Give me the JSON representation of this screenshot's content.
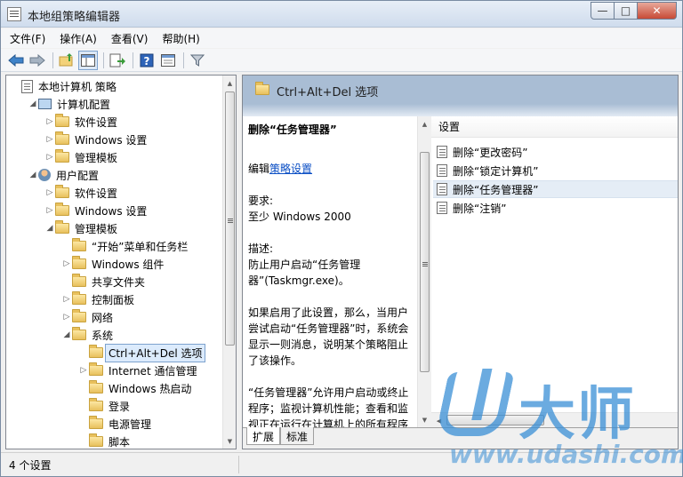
{
  "window": {
    "title": "本地组策略编辑器",
    "caption": {
      "minimize": "—",
      "maximize": "□",
      "close": "✕"
    }
  },
  "menu": [
    "文件(F)",
    "操作(A)",
    "查看(V)",
    "帮助(H)"
  ],
  "toolbar": [
    "back-icon",
    "forward-icon",
    "up-folder-icon",
    "show-hide-tree-icon",
    "export-list-icon",
    "help-icon",
    "properties-icon",
    "filter-icon"
  ],
  "tree": [
    {
      "label": "本地计算机 策略",
      "level": 0,
      "toggle": "",
      "icon": "policy-doc-icon"
    },
    {
      "label": "计算机配置",
      "level": 1,
      "toggle": "◢",
      "icon": "computer-icon"
    },
    {
      "label": "软件设置",
      "level": 2,
      "toggle": "▷",
      "icon": "folder-icon"
    },
    {
      "label": "Windows 设置",
      "level": 2,
      "toggle": "▷",
      "icon": "folder-icon"
    },
    {
      "label": "管理模板",
      "level": 2,
      "toggle": "▷",
      "icon": "folder-icon"
    },
    {
      "label": "用户配置",
      "level": 1,
      "toggle": "◢",
      "icon": "user-icon"
    },
    {
      "label": "软件设置",
      "level": 2,
      "toggle": "▷",
      "icon": "folder-icon"
    },
    {
      "label": "Windows 设置",
      "level": 2,
      "toggle": "▷",
      "icon": "folder-icon"
    },
    {
      "label": "管理模板",
      "level": 2,
      "toggle": "◢",
      "icon": "folder-icon"
    },
    {
      "label": "“开始”菜单和任务栏",
      "level": 3,
      "toggle": "",
      "icon": "folder-icon"
    },
    {
      "label": "Windows 组件",
      "level": 3,
      "toggle": "▷",
      "icon": "folder-icon"
    },
    {
      "label": "共享文件夹",
      "level": 3,
      "toggle": "",
      "icon": "folder-icon"
    },
    {
      "label": "控制面板",
      "level": 3,
      "toggle": "▷",
      "icon": "folder-icon"
    },
    {
      "label": "网络",
      "level": 3,
      "toggle": "▷",
      "icon": "folder-icon"
    },
    {
      "label": "系统",
      "level": 3,
      "toggle": "◢",
      "icon": "folder-icon"
    },
    {
      "label": "Ctrl+Alt+Del 选项",
      "level": 4,
      "toggle": "",
      "icon": "folder-icon",
      "selected": true
    },
    {
      "label": "Internet 通信管理",
      "level": 4,
      "toggle": "▷",
      "icon": "folder-icon"
    },
    {
      "label": "Windows 热启动",
      "level": 4,
      "toggle": "",
      "icon": "folder-icon"
    },
    {
      "label": "登录",
      "level": 4,
      "toggle": "",
      "icon": "folder-icon"
    },
    {
      "label": "电源管理",
      "level": 4,
      "toggle": "",
      "icon": "folder-icon"
    },
    {
      "label": "脚本",
      "level": 4,
      "toggle": "",
      "icon": "folder-icon"
    }
  ],
  "right": {
    "header_title": "Ctrl+Alt+Del 选项",
    "description": {
      "title": "删除“任务管理器”",
      "edit_prefix": "编辑",
      "edit_link": "策略设置",
      "requirements_label": "要求:",
      "requirements_value": "至少 Windows 2000",
      "desc_label": "描述:",
      "desc_p1": "防止用户启动“任务管理器”(Taskmgr.exe)。",
      "desc_p2": "如果启用了此设置，那么，当用户尝试启动“任务管理器”时，系统会显示一则消息，说明某个策略阻止了该操作。",
      "desc_p3": "“任务管理器”允许用户启动或终止程序；监视计算机性能；查看和监视正在运行在计算机上的所有程序"
    },
    "settings_header": "设置",
    "settings": [
      {
        "label": "删除“更改密码”",
        "selected": false
      },
      {
        "label": "删除“锁定计算机”",
        "selected": false
      },
      {
        "label": "删除“任务管理器”",
        "selected": true
      },
      {
        "label": "删除“注销”",
        "selected": false
      }
    ],
    "tabs": [
      {
        "label": "扩展",
        "active": true
      },
      {
        "label": "标准",
        "active": false
      }
    ]
  },
  "status": "4 个设置",
  "watermark": {
    "brand": "大师",
    "url": "www.udashi.com"
  }
}
